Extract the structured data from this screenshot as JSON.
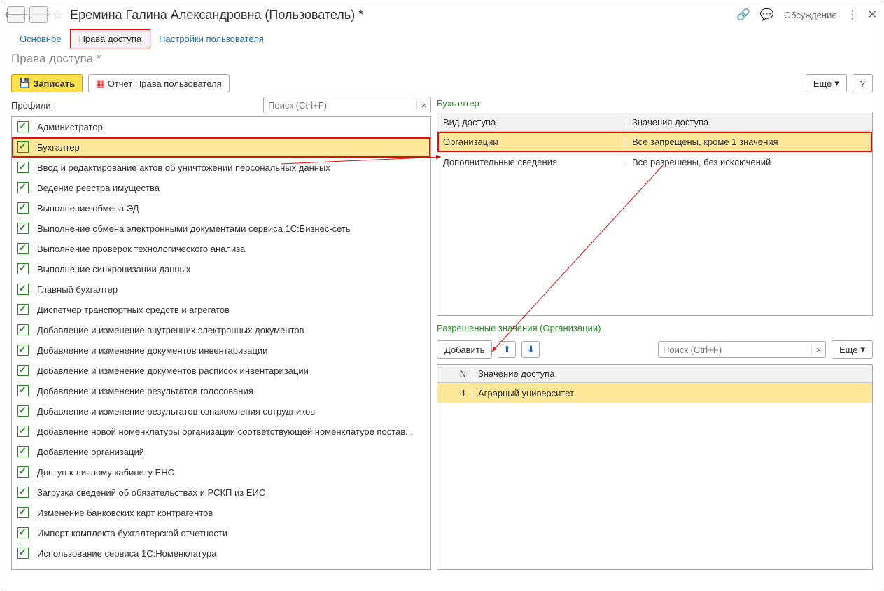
{
  "title": "Еремина Галина Александровна (Пользователь) *",
  "discuss": "Обсуждение",
  "tabs": {
    "main": "Основное",
    "rights": "Права доступа",
    "settings": "Настройки пользователя"
  },
  "subtitle": "Права доступа *",
  "toolbar": {
    "write": "Записать",
    "report": "Отчет Права пользователя",
    "more": "Еще"
  },
  "help": "?",
  "profilesLabel": "Профили:",
  "searchPlaceholder": "Поиск (Ctrl+F)",
  "profiles": [
    "Администратор",
    "Бухгалтер",
    "Ввод и редактирование актов об уничтожении персональных данных",
    "Ведение реестра имущества",
    "Выполнение обмена ЭД",
    "Выполнение обмена электронными документами сервиса 1С:Бизнес-сеть",
    "Выполнение проверок технологического анализа",
    "Выполнение синхронизации данных",
    "Главный бухгалтер",
    "Диспетчер транспортных средств и агрегатов",
    "Добавление и изменение внутренних электронных документов",
    "Добавление и изменение документов инвентаризации",
    "Добавление и изменение документов расписок инвентаризации",
    "Добавление и изменение результатов голосования",
    "Добавление и изменение результатов ознакомления сотрудников",
    "Добавление новой номенклатуры организации соответствующей номенклатуре постав...",
    "Добавление организаций",
    "Доступ к личному кабинету ЕНС",
    "Загрузка сведений об обязательствах и РСКП из ЕИС",
    "Изменение банковских карт контрагентов",
    "Импорт комплекта бухгалтерской отчетности",
    "Использование сервиса 1С:Номенклатура"
  ],
  "selectedProfile": "Бухгалтер",
  "accessHead": {
    "kind": "Вид доступа",
    "values": "Значения доступа"
  },
  "accessRows": [
    {
      "kind": "Организации",
      "value": "Все запрещены, кроме 1 значения",
      "sel": true
    },
    {
      "kind": "Дополнительные сведения",
      "value": "Все разрешены, без исключений",
      "sel": false
    }
  ],
  "allowedTitle": "Разрешенные значения (Организации)",
  "addBtn": "Добавить",
  "valHead": {
    "n": "N",
    "val": "Значение доступа"
  },
  "valRows": [
    {
      "n": "1",
      "val": "Аграрный университет"
    }
  ]
}
